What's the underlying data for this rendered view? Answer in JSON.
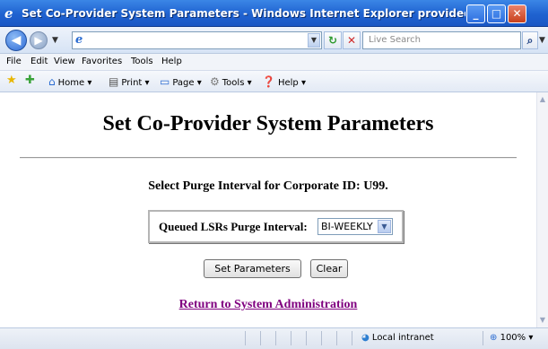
{
  "window": {
    "title": "Set Co-Provider System Parameters - Windows Internet Explorer provided by Qwest Communic...",
    "minimize_glyph": "_",
    "maximize_glyph": "□",
    "close_glyph": "✕"
  },
  "navbar": {
    "back_glyph": "◀",
    "forward_glyph": "▶",
    "address_value": "",
    "search_placeholder": "Live Search"
  },
  "menubar": {
    "items": [
      "File",
      "Edit",
      "View",
      "Favorites",
      "Tools",
      "Help"
    ]
  },
  "commandbar": {
    "home": "Home",
    "print": "Print",
    "page": "Page",
    "tools": "Tools",
    "help": "Help"
  },
  "page": {
    "title": "Set Co-Provider System Parameters",
    "subtitle": "Select Purge Interval for Corporate ID: U99.",
    "purge_label": "Queued LSRs Purge Interval:",
    "purge_value": "BI-WEEKLY",
    "set_button": "Set Parameters",
    "clear_button": "Clear",
    "return_link": "Return to System Administration"
  },
  "statusbar": {
    "zone": "Local intranet",
    "zoom": "100%"
  },
  "colors": {
    "title_bar": "#1f62d0",
    "visited_link": "#800080"
  }
}
